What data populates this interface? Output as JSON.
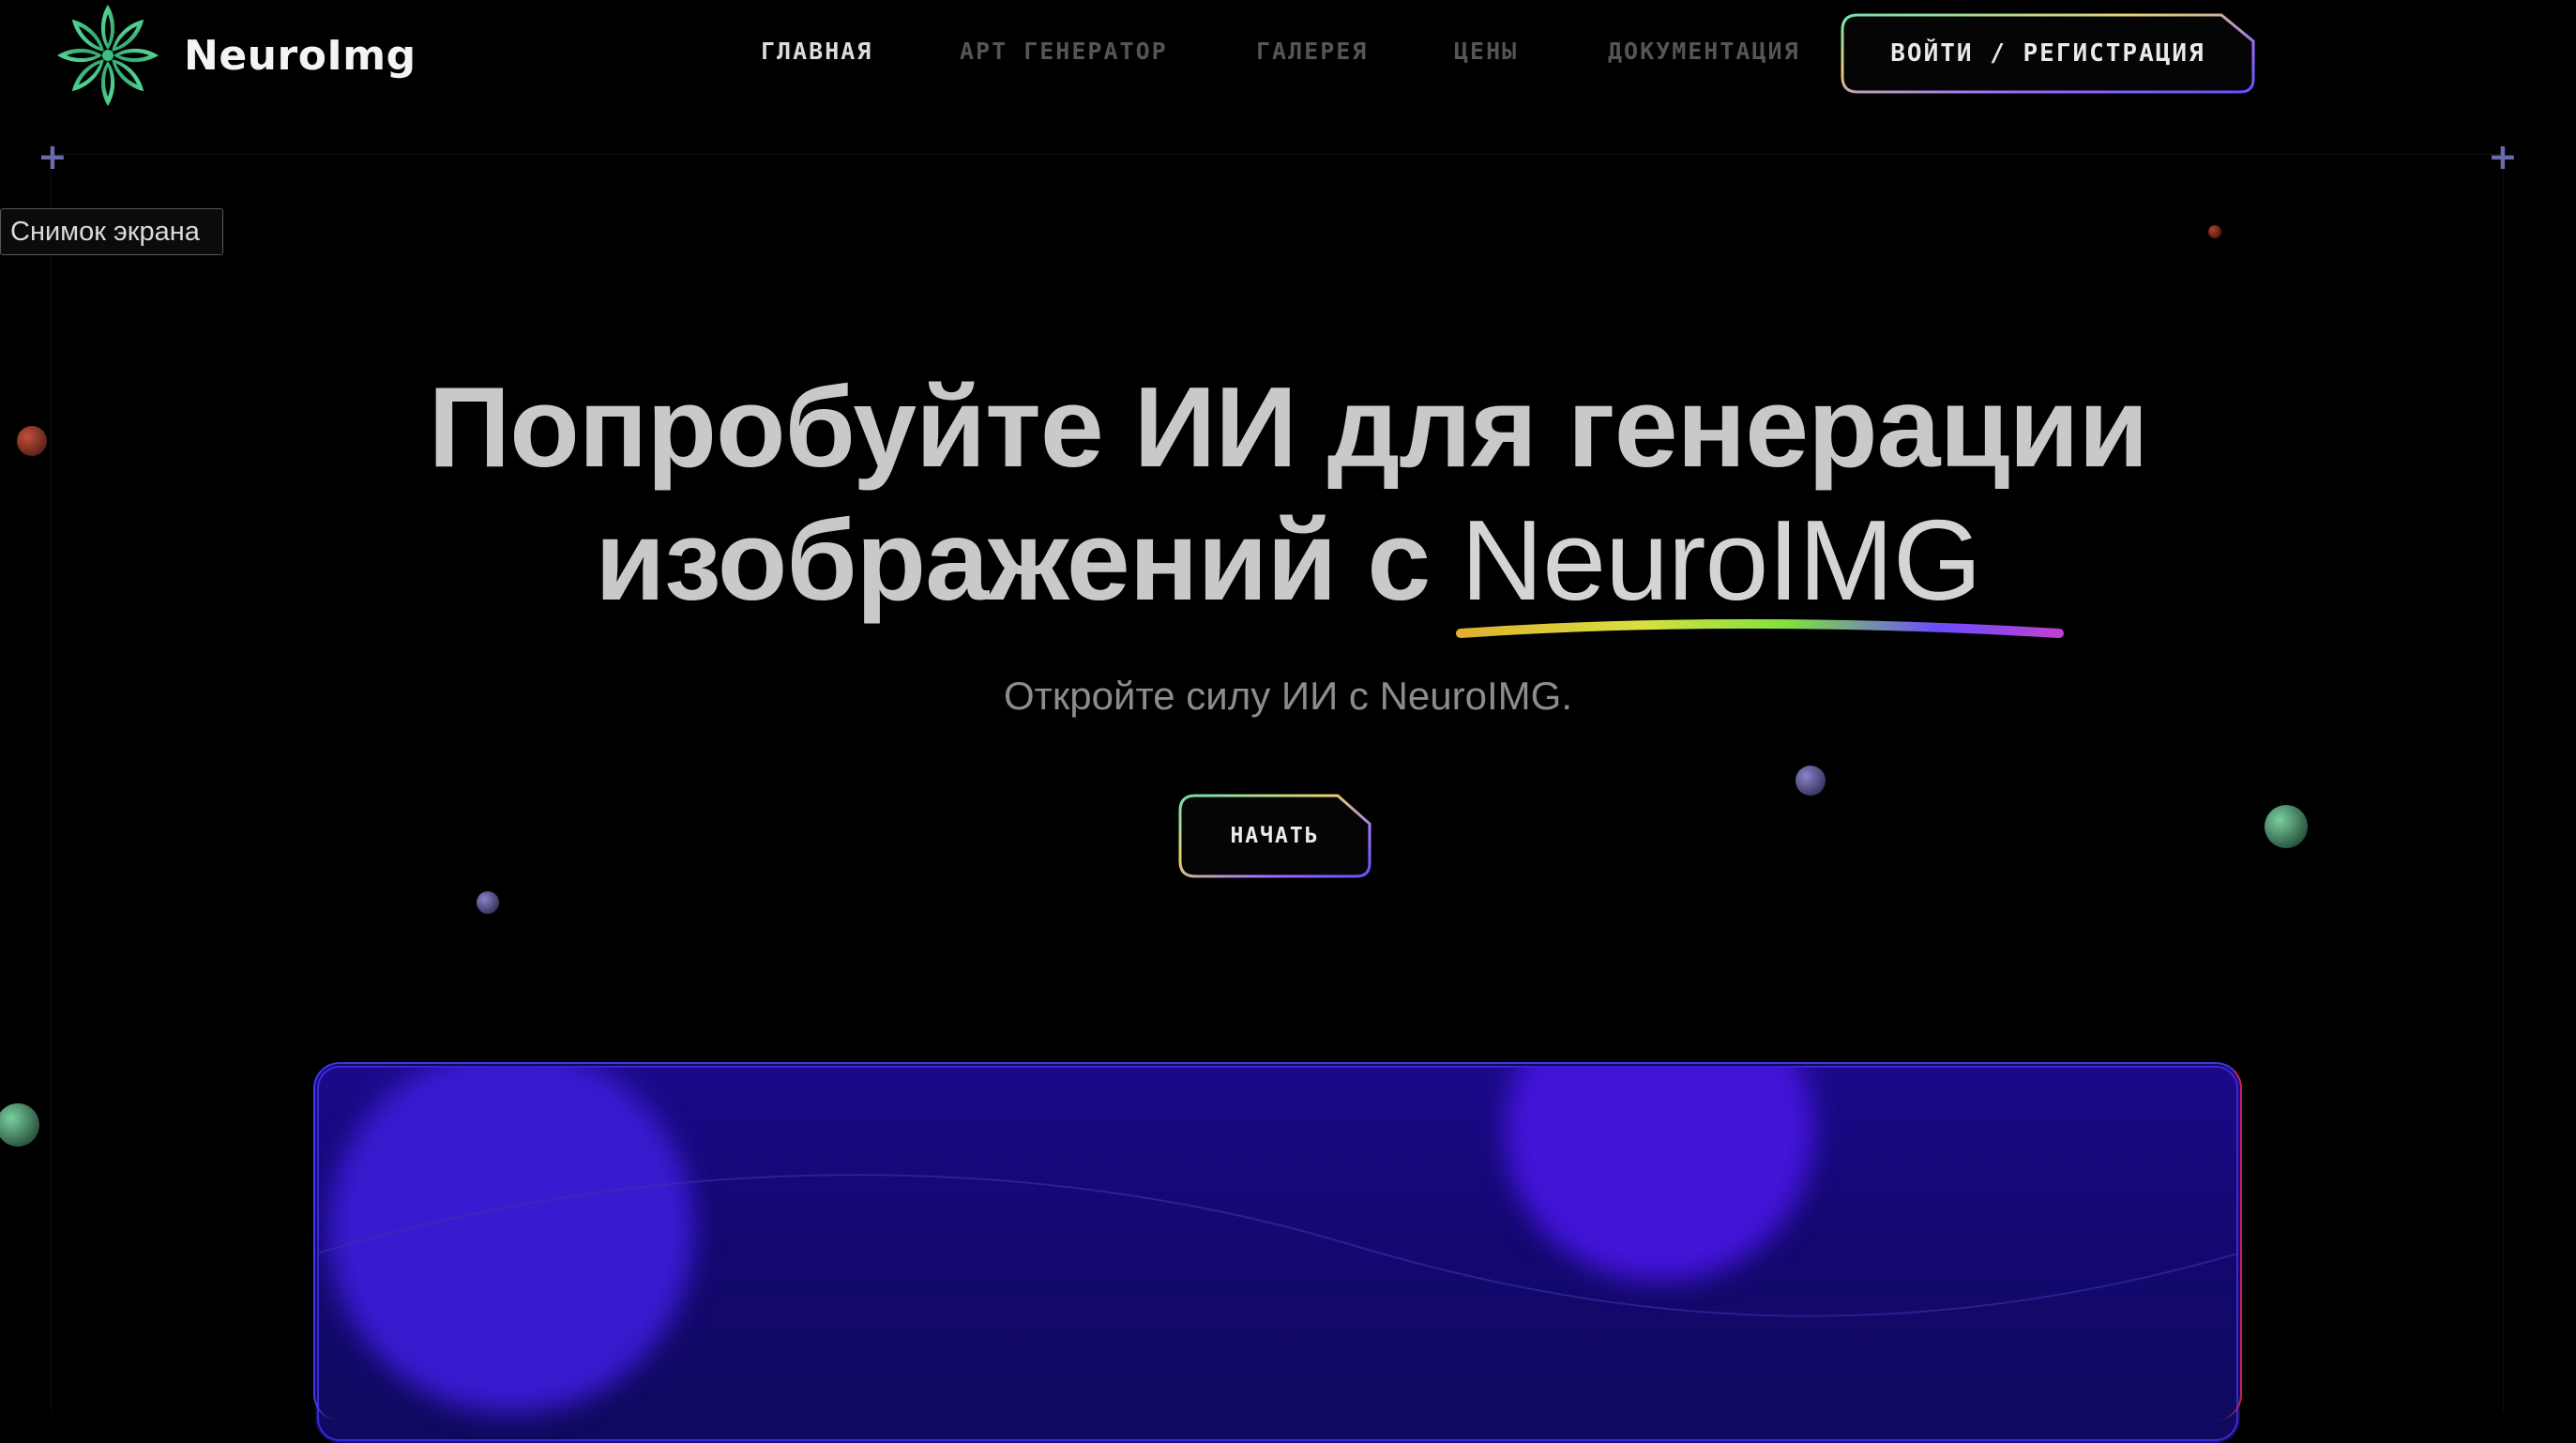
{
  "header": {
    "brand": "NeuroImg",
    "nav": [
      {
        "label": "ГЛАВНАЯ",
        "active": true
      },
      {
        "label": "АРТ ГЕНЕРАТОР",
        "active": false
      },
      {
        "label": "ГАЛЕРЕЯ",
        "active": false
      },
      {
        "label": "ЦЕНЫ",
        "active": false
      },
      {
        "label": "ДОКУМЕНТАЦИЯ",
        "active": false
      }
    ],
    "login_label": "ВОЙТИ / РЕГИСТРАЦИЯ"
  },
  "tooltip": "Снимок экрана",
  "hero": {
    "title_line1": "Попробуйте ИИ для генерации",
    "title_line2_prefix": "изображений с ",
    "title_brand": "NeuroIMG",
    "subtitle": "Откройте силу ИИ с NeuroIMG.",
    "cta_label": "НАЧАТЬ"
  },
  "colors": {
    "background": "#000000",
    "brand_green": "#3fbf7f",
    "accent_purple": "#7b5cff",
    "panel_blue": "#1b0a8a"
  },
  "icons": {
    "logo": "flower-logo-icon",
    "corner_marks": "plus-icon"
  }
}
